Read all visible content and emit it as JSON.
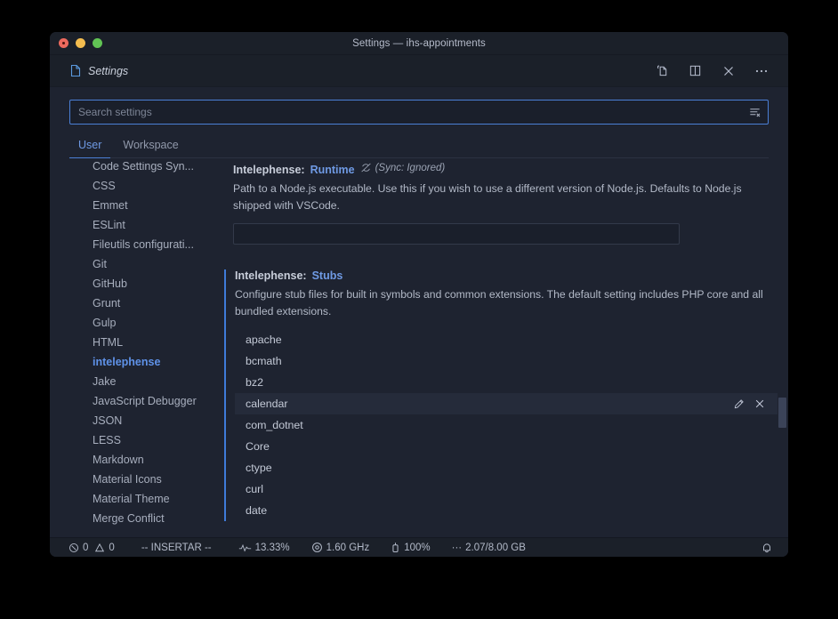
{
  "window": {
    "title": "Settings — ihs-appointments",
    "traffic_lights": [
      "close-red",
      "minimize-yellow",
      "maximize-green"
    ]
  },
  "tab": {
    "label": "Settings",
    "icon": "settings-file-icon",
    "actions": [
      {
        "name": "open-settings-json-icon",
        "title": "Open Settings (JSON)"
      },
      {
        "name": "split-editor-icon",
        "title": "Split Editor"
      },
      {
        "name": "close-icon",
        "title": "Close"
      },
      {
        "name": "more-actions-icon",
        "title": "More Actions..."
      }
    ]
  },
  "search": {
    "placeholder": "Search settings",
    "value": "",
    "clear_filter_icon": "clear-filter-icon"
  },
  "scope_tabs": [
    {
      "label": "User",
      "active": true
    },
    {
      "label": "Workspace",
      "active": false
    }
  ],
  "toc": {
    "items": [
      {
        "label": "Code Settings Syn...",
        "selected": false,
        "clipped": true
      },
      {
        "label": "CSS",
        "selected": false
      },
      {
        "label": "Emmet",
        "selected": false
      },
      {
        "label": "ESLint",
        "selected": false
      },
      {
        "label": "Fileutils configurati...",
        "selected": false
      },
      {
        "label": "Git",
        "selected": false
      },
      {
        "label": "GitHub",
        "selected": false
      },
      {
        "label": "Grunt",
        "selected": false
      },
      {
        "label": "Gulp",
        "selected": false
      },
      {
        "label": "HTML",
        "selected": false
      },
      {
        "label": "intelephense",
        "selected": true
      },
      {
        "label": "Jake",
        "selected": false
      },
      {
        "label": "JavaScript Debugger",
        "selected": false
      },
      {
        "label": "JSON",
        "selected": false
      },
      {
        "label": "LESS",
        "selected": false
      },
      {
        "label": "Markdown",
        "selected": false
      },
      {
        "label": "Material Icons",
        "selected": false
      },
      {
        "label": "Material Theme",
        "selected": false
      },
      {
        "label": "Merge Conflict",
        "selected": false
      }
    ]
  },
  "settings": {
    "runtime": {
      "prefix": "Intelephense: ",
      "key": "Runtime",
      "sync_note": "(Sync: Ignored)",
      "sync_icon": "sync-ignored-icon",
      "description": "Path to a Node.js executable. Use this if you wish to use a different version of Node.js. Defaults to Node.js shipped with VSCode.",
      "input_value": "",
      "input_placeholder": ""
    },
    "stubs": {
      "prefix": "Intelephense: ",
      "key": "Stubs",
      "description": "Configure stub files for built in symbols and common extensions. The default setting includes PHP core and all bundled extensions.",
      "modified": true,
      "items": [
        {
          "value": "apache",
          "hovered": false
        },
        {
          "value": "bcmath",
          "hovered": false
        },
        {
          "value": "bz2",
          "hovered": false
        },
        {
          "value": "calendar",
          "hovered": true
        },
        {
          "value": "com_dotnet",
          "hovered": false
        },
        {
          "value": "Core",
          "hovered": false
        },
        {
          "value": "ctype",
          "hovered": false
        },
        {
          "value": "curl",
          "hovered": false
        },
        {
          "value": "date",
          "hovered": false
        }
      ],
      "row_actions": [
        {
          "name": "edit-item-icon",
          "title": "Edit Item"
        },
        {
          "name": "remove-item-icon",
          "title": "Remove Item"
        }
      ]
    }
  },
  "statusbar": {
    "errors": "0",
    "warnings": "0",
    "mode": "-- INSERTAR --",
    "cpu_load": "13.33%",
    "cpu_freq": "1.60 GHz",
    "battery": "100%",
    "memory": "2.07/8.00 GB",
    "memory_prefix": "···",
    "notifications_icon": "bell-icon"
  },
  "colors": {
    "accent": "#4b7fd6",
    "accent_text": "#6f9ae4",
    "background": "#1e2330",
    "chrome": "#1b2029",
    "text": "#c8ceda"
  }
}
